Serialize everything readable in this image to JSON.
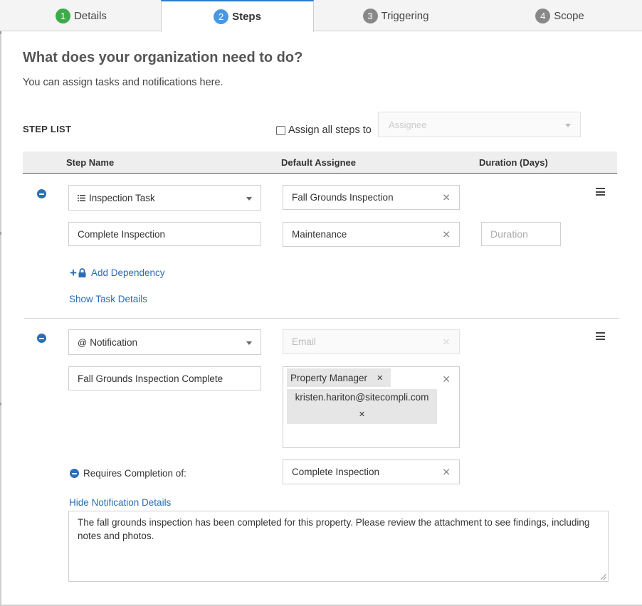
{
  "tabs": [
    {
      "num": "1",
      "label": "Details"
    },
    {
      "num": "2",
      "label": "Steps"
    },
    {
      "num": "3",
      "label": "Triggering"
    },
    {
      "num": "4",
      "label": "Scope"
    }
  ],
  "page": {
    "heading": "What does your organization need to do?",
    "subheading": "You can assign tasks and notifications here."
  },
  "step_list": {
    "label": "STEP LIST",
    "assign_all_label": "Assign all steps to",
    "assign_all_checked": false,
    "assignee_placeholder": "Assignee"
  },
  "table_header": {
    "step_name": "Step Name",
    "default_assignee": "Default Assignee",
    "duration": "Duration (Days)"
  },
  "steps": [
    {
      "type_icon": "list-icon",
      "type_label": "Inspection Task",
      "assignee_top": "Fall Grounds Inspection",
      "name": "Complete Inspection",
      "assignee": "Maintenance",
      "duration_placeholder": "Duration",
      "add_dependency": "Add Dependency",
      "details_link": "Show Task Details"
    },
    {
      "type_icon": "at-icon",
      "type_label": "Notification",
      "email_placeholder": "Email",
      "name": "Fall Grounds Inspection Complete",
      "recipients": [
        "Property Manager",
        "kristen.hariton@sitecompli.com"
      ],
      "requires_label": "Requires Completion of:",
      "requires_value": "Complete Inspection",
      "details_link": "Hide Notification Details",
      "message": "The fall grounds inspection has been completed for this property. Please review the attachment to see findings, including notes and photos."
    }
  ],
  "colors": {
    "tab_active": "#2b7bd0",
    "tab1_badge": "#3eaa4a",
    "link": "#2a6cb5"
  }
}
